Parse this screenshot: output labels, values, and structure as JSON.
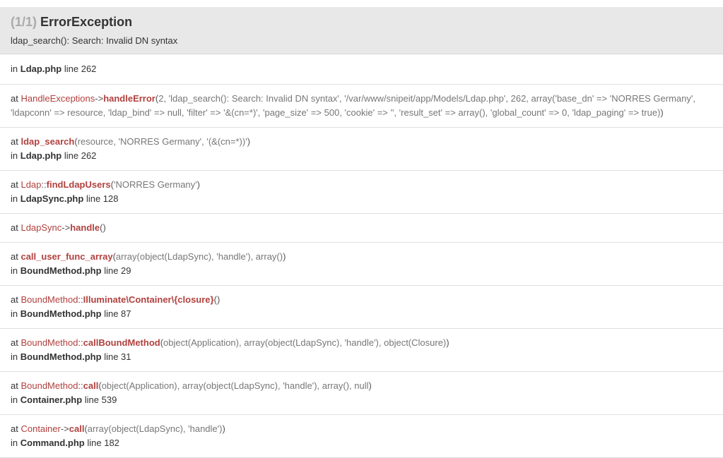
{
  "header": {
    "counter": "(1/1)",
    "exception": "ErrorException",
    "message": "ldap_search(): Search: Invalid DN syntax"
  },
  "first_location": {
    "in": "in",
    "file": "Ldap.php",
    "line_text": "line 262"
  },
  "frames": [
    {
      "at": "at",
      "class": "HandleExceptions",
      "sep": "->",
      "function": "handleError",
      "args": "2, 'ldap_search(): Search: Invalid DN syntax', '/var/www/snipeit/app/Models/Ldap.php', 262, array('base_dn' => 'NORRES Germany', 'ldapconn' => resource, 'ldap_bind' => null, 'filter' => '&(cn=*)', 'page_size' => 500, 'cookie' => '', 'result_set' => array(), 'global_count' => 0, 'ldap_paging' => true)"
    },
    {
      "at": "at",
      "class": "",
      "sep": "",
      "function": "ldap_search",
      "args": "resource, 'NORRES Germany', '(&(cn=*))'",
      "in": "in",
      "file": "Ldap.php",
      "line_text": "line 262"
    },
    {
      "at": "at",
      "class": "Ldap",
      "sep": "::",
      "function": "findLdapUsers",
      "args": "'NORRES Germany'",
      "in": "in",
      "file": "LdapSync.php",
      "line_text": "line 128"
    },
    {
      "at": "at",
      "class": "LdapSync",
      "sep": "->",
      "function": "handle",
      "args": ""
    },
    {
      "at": "at",
      "class": "",
      "sep": "",
      "function": "call_user_func_array",
      "args": "array(object(LdapSync), 'handle'), array()",
      "in": "in",
      "file": "BoundMethod.php",
      "line_text": "line 29"
    },
    {
      "at": "at",
      "class": "BoundMethod",
      "sep": "::",
      "function": "Illuminate\\Container\\{closure}",
      "args": "",
      "in": "in",
      "file": "BoundMethod.php",
      "line_text": "line 87"
    },
    {
      "at": "at",
      "class": "BoundMethod",
      "sep": "::",
      "function": "callBoundMethod",
      "args": "object(Application), array(object(LdapSync), 'handle'), object(Closure)",
      "in": "in",
      "file": "BoundMethod.php",
      "line_text": "line 31"
    },
    {
      "at": "at",
      "class": "BoundMethod",
      "sep": "::",
      "function": "call",
      "args": "object(Application), array(object(LdapSync), 'handle'), array(), null",
      "in": "in",
      "file": "Container.php",
      "line_text": "line 539"
    },
    {
      "at": "at",
      "class": "Container",
      "sep": "->",
      "function": "call",
      "args": "array(object(LdapSync), 'handle')",
      "in": "in",
      "file": "Command.php",
      "line_text": "line 182"
    }
  ],
  "colors": {
    "accent": "#b0413e",
    "header_bg": "#e8e8e8"
  }
}
